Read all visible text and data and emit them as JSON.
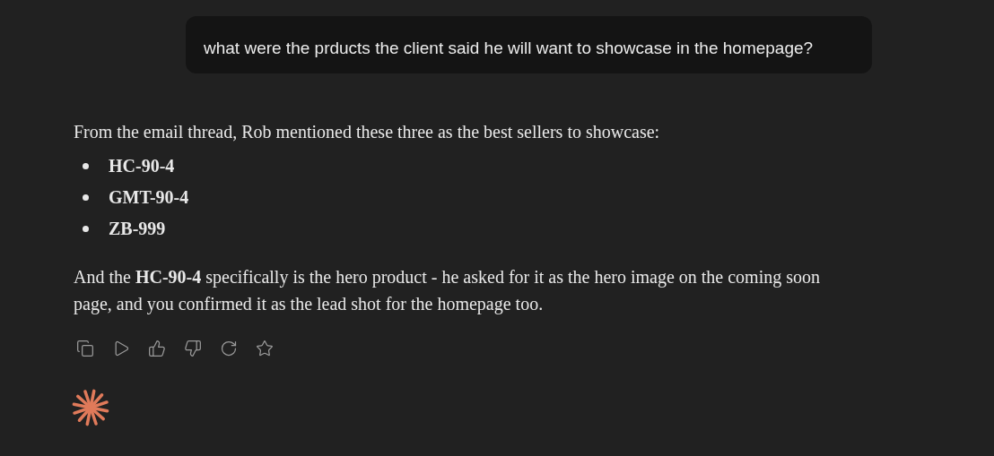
{
  "user_message": {
    "text": "what were the prducts the client said he will want to showcase in the homepage?"
  },
  "response": {
    "intro": "From the email thread, Rob mentioned these three as the best sellers to showcase:",
    "items": [
      "HC-90-4",
      "GMT-90-4",
      "ZB-999"
    ],
    "closing": "And the **HC-90-4** specifically is the hero product - he asked for it as the hero image on the coming soon page, and you confirmed it as the lead shot for the homepage too."
  }
}
